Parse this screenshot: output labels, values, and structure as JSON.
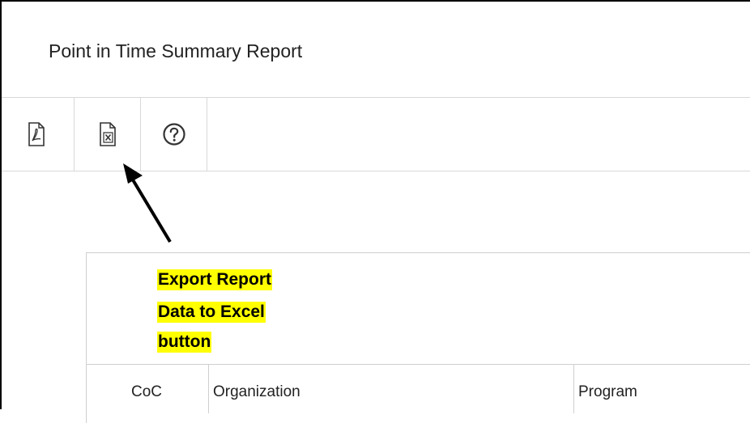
{
  "page": {
    "title": "Point in Time Summary Report"
  },
  "toolbar": {
    "buttons": [
      {
        "icon": "pdf-icon",
        "action": "export-pdf"
      },
      {
        "icon": "excel-icon",
        "action": "export-excel"
      },
      {
        "icon": "help-icon",
        "action": "help"
      }
    ]
  },
  "callout": {
    "line1": "Export Report",
    "line2": "Data to Excel",
    "line3": "button",
    "highlight_color": "#ffff00"
  },
  "table": {
    "headers": [
      "CoC",
      "Organization",
      "Program"
    ]
  },
  "colors": {
    "border": "#d8d8d8",
    "text": "#222222"
  }
}
